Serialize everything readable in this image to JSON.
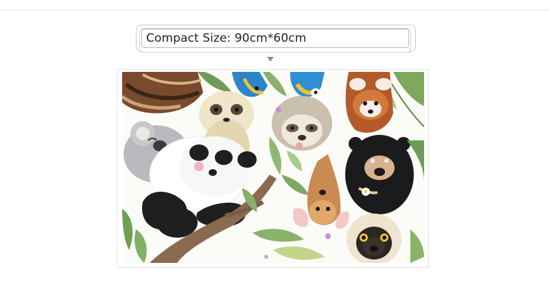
{
  "size_label": "Compact Size: 90cm*60cm",
  "artwork": {
    "icon": "wall-sticker-jungle-animals-image",
    "subjects": [
      "red-panda",
      "meerkat",
      "macaw",
      "koala",
      "panda",
      "sloth",
      "fox",
      "sun-bear",
      "pug",
      "tree-branch",
      "tropical-leaves"
    ]
  },
  "colors": {
    "pointer": "#8b9377",
    "label_border": "#b8b8b8"
  }
}
